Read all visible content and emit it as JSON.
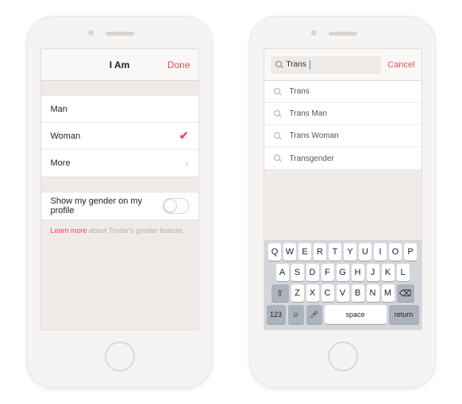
{
  "left": {
    "nav": {
      "title": "I Am",
      "done": "Done"
    },
    "options": {
      "man": "Man",
      "woman": "Woman",
      "more": "More"
    },
    "selected": "woman",
    "toggle": {
      "label": "Show my gender on my profile",
      "on": false
    },
    "footnote": {
      "link": "Learn more",
      "text": " about Tinder's gender feature."
    }
  },
  "right": {
    "search": {
      "query": "Trans",
      "cancel": "Cancel"
    },
    "results": [
      "Trans",
      "Trans Man",
      "Trans Woman",
      "Transgender"
    ],
    "keyboard": {
      "r1": [
        "Q",
        "W",
        "E",
        "R",
        "T",
        "Y",
        "U",
        "I",
        "O",
        "P"
      ],
      "r2": [
        "A",
        "S",
        "D",
        "F",
        "G",
        "H",
        "J",
        "K",
        "L"
      ],
      "r3": [
        "Z",
        "X",
        "C",
        "V",
        "B",
        "N",
        "M"
      ],
      "mods": {
        "num": "123",
        "space": "space",
        "ret": "return"
      }
    }
  }
}
